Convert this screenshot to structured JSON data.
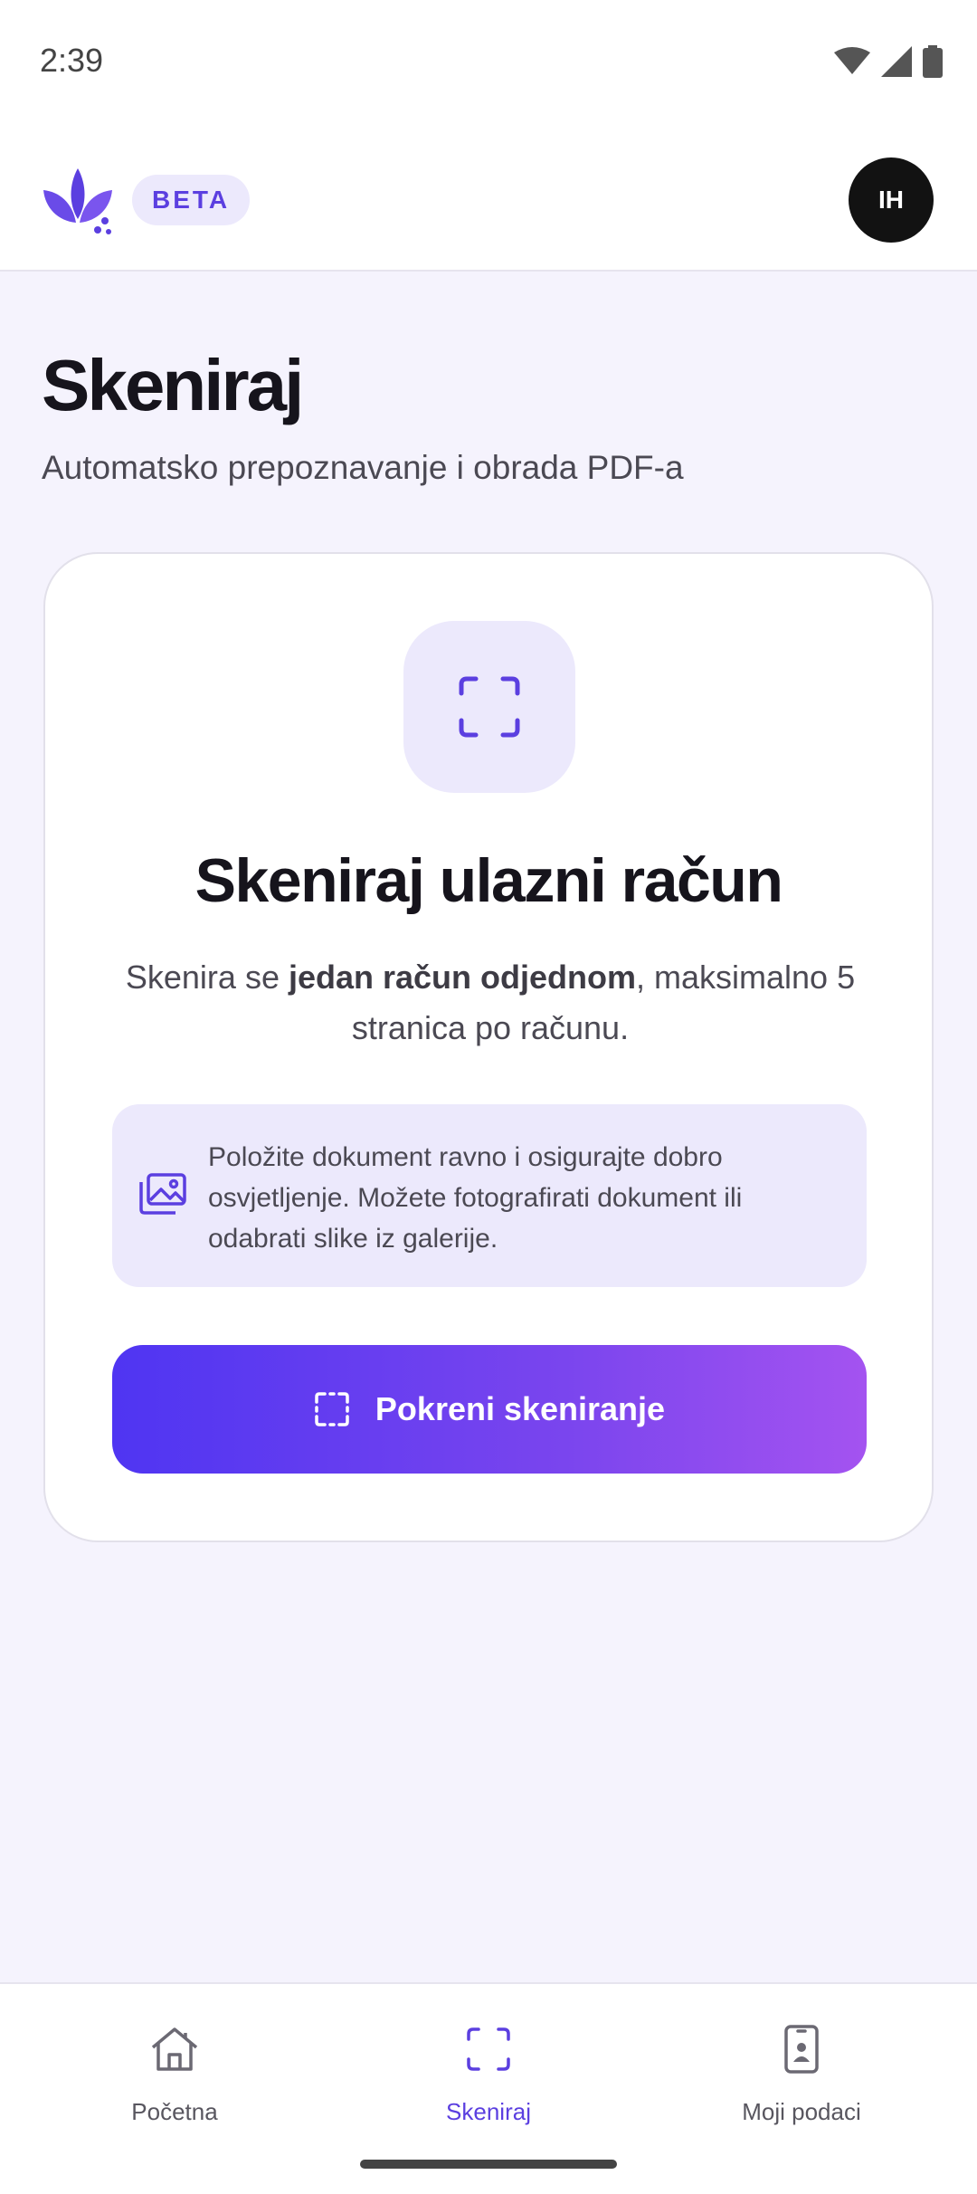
{
  "status_bar": {
    "time": "2:39",
    "icons": [
      "wifi-icon",
      "cell-signal-icon",
      "battery-icon"
    ]
  },
  "header": {
    "logo": "leaf-logo-icon",
    "badge": "BETA",
    "avatar_initials": "IH"
  },
  "page": {
    "title": "Skeniraj",
    "subtitle": "Automatsko prepoznavanje i obrada PDF-a"
  },
  "card": {
    "icon": "scan-frame-icon",
    "title": "Skeniraj ulazni račun",
    "desc_prefix": "Skenira se ",
    "desc_bold": "jedan račun odjednom",
    "desc_suffix": ", maksimalno 5 stranica po računu.",
    "tip_icon": "images-icon",
    "tip": "Položite dokument ravno i osigurajte dobro osvjetljenje. Možete fotografirati dokument ili odabrati slike iz galerije.",
    "button_label": "Pokreni skeniranje"
  },
  "nav": {
    "items": [
      {
        "label": "Početna",
        "icon": "home-icon"
      },
      {
        "label": "Skeniraj",
        "icon": "scan-icon",
        "active": true
      },
      {
        "label": "Moji podaci",
        "icon": "phone-profile-icon"
      }
    ]
  },
  "colors": {
    "accent": "#5b3fe0",
    "accent_light": "#ece9fc",
    "button_start": "#4f35f2",
    "button_end": "#a453f0"
  }
}
